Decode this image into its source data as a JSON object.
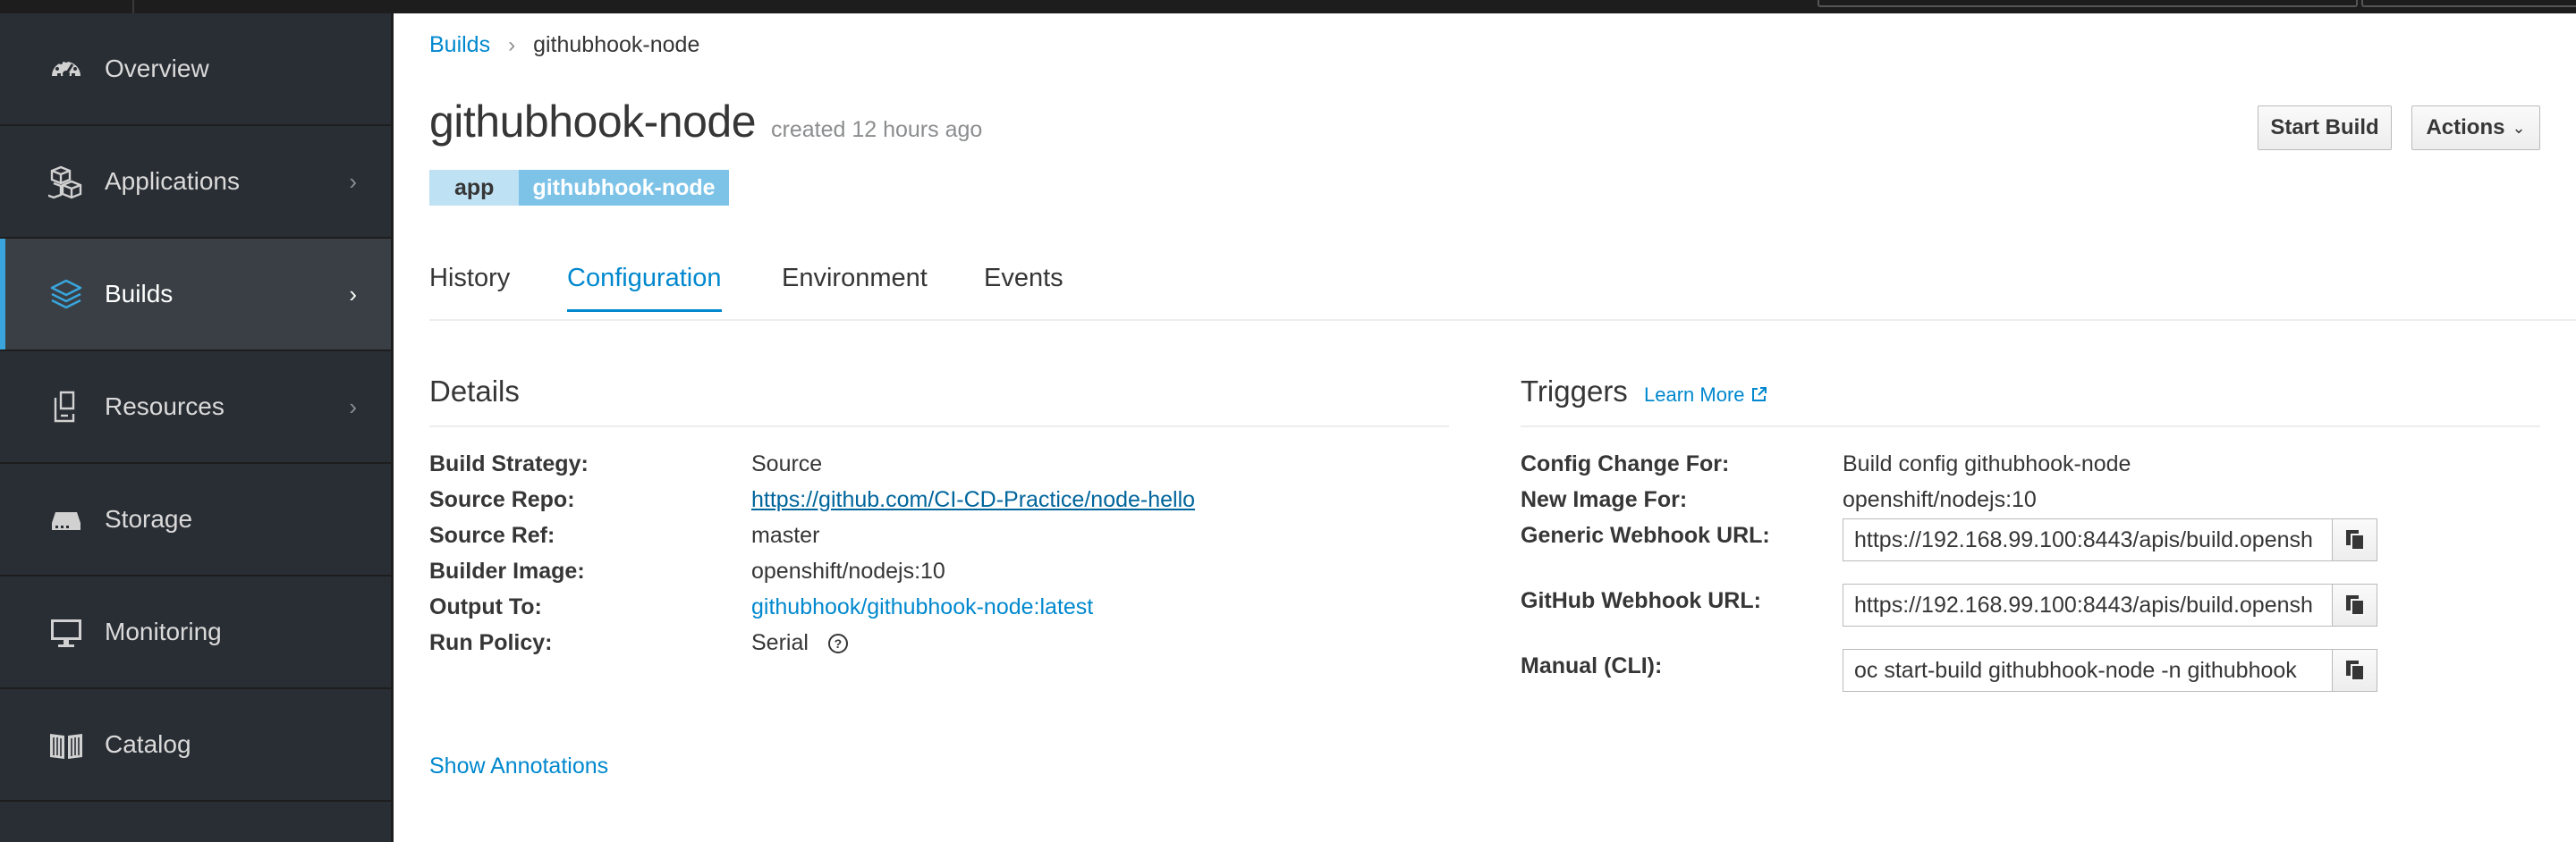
{
  "nav": {
    "items": [
      {
        "label": "Overview",
        "icon": "dashboard-icon",
        "has_chevron": false
      },
      {
        "label": "Applications",
        "icon": "cubes-icon",
        "has_chevron": true
      },
      {
        "label": "Builds",
        "icon": "layers-icon",
        "has_chevron": true,
        "active": true
      },
      {
        "label": "Resources",
        "icon": "resources-icon",
        "has_chevron": true
      },
      {
        "label": "Storage",
        "icon": "hard-drive-icon",
        "has_chevron": false
      },
      {
        "label": "Monitoring",
        "icon": "monitor-icon",
        "has_chevron": false
      },
      {
        "label": "Catalog",
        "icon": "book-icon",
        "has_chevron": false
      }
    ],
    "chevron": "›"
  },
  "breadcrumb": {
    "parent": "Builds",
    "separator": "›",
    "current": "githubhook-node"
  },
  "header": {
    "title": "githubhook-node",
    "created": "created 12 hours ago",
    "start_build": "Start Build",
    "actions": "Actions",
    "actions_caret": "⌄"
  },
  "labels": {
    "key": "app",
    "value": "githubhook-node"
  },
  "tabs": [
    {
      "label": "History",
      "active": false
    },
    {
      "label": "Configuration",
      "active": true
    },
    {
      "label": "Environment",
      "active": false
    },
    {
      "label": "Events",
      "active": false
    }
  ],
  "details": {
    "title": "Details",
    "rows": [
      {
        "label": "Build Strategy:",
        "value": "Source"
      },
      {
        "label": "Source Repo:",
        "value": "https://github.com/CI-CD-Practice/node-hello"
      },
      {
        "label": "Source Ref:",
        "value": "master"
      },
      {
        "label": "Builder Image:",
        "value": "openshift/nodejs:10"
      },
      {
        "label": "Output To:",
        "value": "githubhook/githubhook-node:latest"
      },
      {
        "label": "Run Policy:",
        "value": "Serial"
      }
    ],
    "help_icon": "?",
    "show_annotations": "Show Annotations"
  },
  "triggers": {
    "title": "Triggers",
    "learn_more": "Learn More",
    "config_change_label": "Config Change For:",
    "config_change_value": "Build config githubhook-node",
    "new_image_label": "New Image For:",
    "new_image_value": "openshift/nodejs:10",
    "generic_label": "Generic Webhook URL:",
    "generic_value": "https://192.168.99.100:8443/apis/build.opensh",
    "github_label": "GitHub Webhook URL:",
    "github_value": "https://192.168.99.100:8443/apis/build.opensh",
    "manual_label": "Manual (CLI):",
    "manual_value": "oc start-build githubhook-node -n githubhook"
  },
  "colors": {
    "accent": "#0088ce",
    "sidebar": "#292e34",
    "label_key": "#bee1f4",
    "label_value": "#7dc3e8"
  }
}
